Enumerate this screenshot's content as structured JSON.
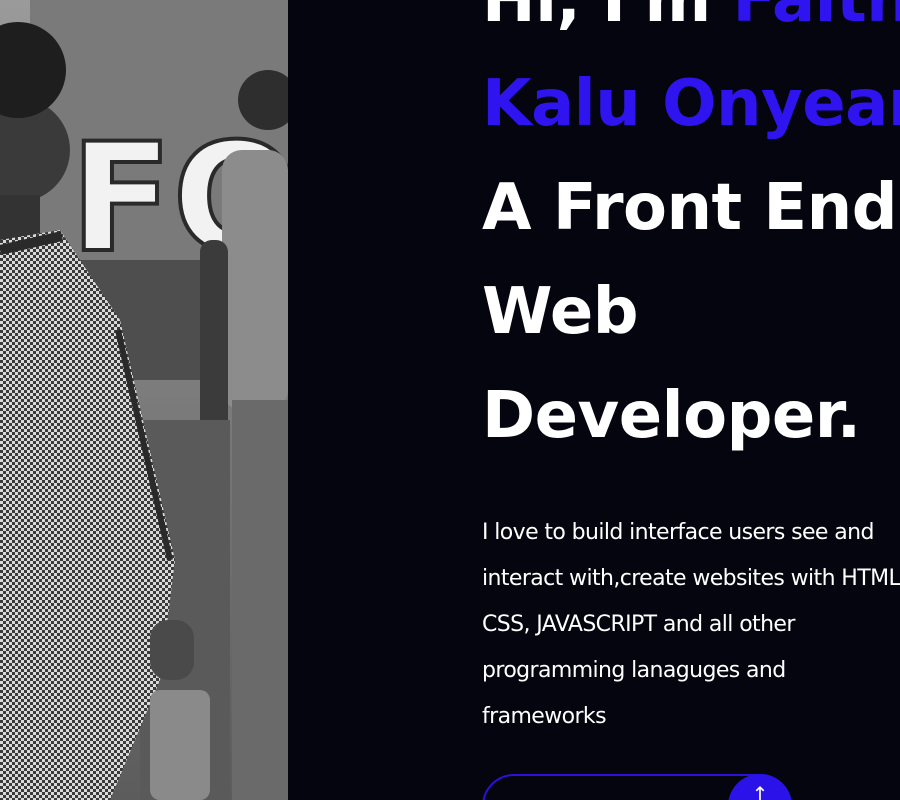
{
  "colors": {
    "background": "#04050f",
    "text": "#ffffff",
    "accent": "#2f14f0",
    "button_border": "#2a12d8",
    "button_fill": "#2a12e8"
  },
  "photo": {
    "description_icon": "profile-photo",
    "banner_text": "FOR"
  },
  "hero": {
    "greeting": "Hi, I'm",
    "name_first": "Faith",
    "name_rest": "Kalu Onyeanu",
    "title_line1": "A Front End",
    "title_line2": "Web",
    "title_line3": "Developer.",
    "intro_lines": [
      "I love to build interface users see and",
      "interact with,create websites with HTML,",
      "CSS, JAVASCRIPT and all other",
      "programming lanaguges and",
      "frameworks"
    ]
  },
  "cta": {
    "label": "",
    "icon": "arrow-icon"
  }
}
